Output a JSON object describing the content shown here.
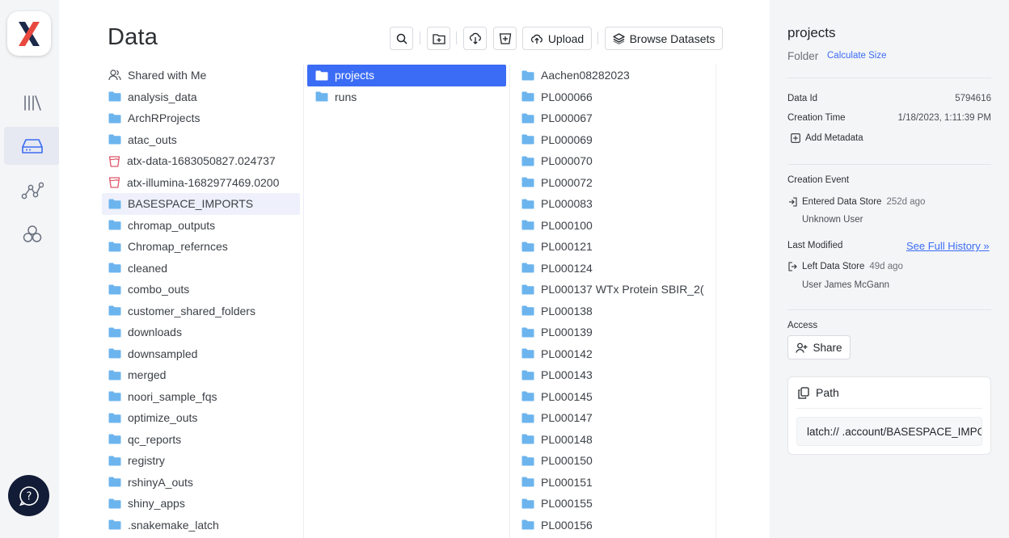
{
  "main": {
    "title": "Data",
    "toolbar": {
      "upload_label": "Upload",
      "browse_label": "Browse Datasets"
    }
  },
  "columns": {
    "root": [
      {
        "label": "Shared with Me",
        "icon": "users-icon"
      },
      {
        "label": "analysis_data",
        "icon": "folder-icon"
      },
      {
        "label": "ArchRProjects",
        "icon": "folder-icon"
      },
      {
        "label": "atac_outs",
        "icon": "folder-icon"
      },
      {
        "label": "atx-data-1683050827.024737",
        "icon": "bucket-icon"
      },
      {
        "label": "atx-illumina-1682977469.0200",
        "icon": "bucket-icon"
      },
      {
        "label": "BASESPACE_IMPORTS",
        "icon": "folder-icon",
        "selected": true
      },
      {
        "label": "chromap_outputs",
        "icon": "folder-icon"
      },
      {
        "label": "Chromap_refernces",
        "icon": "folder-icon"
      },
      {
        "label": "cleaned",
        "icon": "folder-icon"
      },
      {
        "label": "combo_outs",
        "icon": "folder-icon"
      },
      {
        "label": "customer_shared_folders",
        "icon": "folder-icon"
      },
      {
        "label": "downloads",
        "icon": "folder-icon"
      },
      {
        "label": "downsampled",
        "icon": "folder-icon"
      },
      {
        "label": "merged",
        "icon": "folder-icon"
      },
      {
        "label": "noori_sample_fqs",
        "icon": "folder-icon"
      },
      {
        "label": "optimize_outs",
        "icon": "folder-icon"
      },
      {
        "label": "qc_reports",
        "icon": "folder-icon"
      },
      {
        "label": "registry",
        "icon": "folder-icon"
      },
      {
        "label": "rshinyA_outs",
        "icon": "folder-icon"
      },
      {
        "label": "shiny_apps",
        "icon": "folder-icon"
      },
      {
        "label": ".snakemake_latch",
        "icon": "folder-icon"
      }
    ],
    "second": [
      {
        "label": "projects",
        "active": true
      },
      {
        "label": "runs"
      }
    ],
    "third": [
      "Aachen08282023",
      "PL000066",
      "PL000067",
      "PL000069",
      "PL000070",
      "PL000072",
      "PL000083",
      "PL000100",
      "PL000121",
      "PL000124",
      "PL000137 WTx Protein SBIR_2(",
      "PL000138",
      "PL000139",
      "PL000142",
      "PL000143",
      "PL000145",
      "PL000147",
      "PL000148",
      "PL000150",
      "PL000151",
      "PL000155",
      "PL000156"
    ]
  },
  "panel": {
    "title": "projects",
    "type": "Folder",
    "calculate_size": "Calculate Size",
    "data_id_label": "Data Id",
    "data_id_value": "5794616",
    "creation_time_label": "Creation Time",
    "creation_time_value": "1/18/2023, 1:11:39 PM",
    "add_metadata": "Add Metadata",
    "creation_event_label": "Creation Event",
    "creation_event_text": "Entered Data Store",
    "creation_event_age": "252d ago",
    "creation_event_user": "Unknown User",
    "last_modified_label": "Last Modified",
    "see_history": "See Full History »",
    "modified_text": "Left Data Store",
    "modified_age": "49d ago",
    "modified_user": "User James McGann",
    "access_label": "Access",
    "share_label": "Share",
    "path_label": "Path",
    "path_value": "latch://          .account/BASESPACE_IMPORTS/projects"
  },
  "colors": {
    "accent": "#3b6cf5",
    "folder": "#6cb4ee",
    "bucket": "#e0566b",
    "help_bg": "#121c36"
  }
}
